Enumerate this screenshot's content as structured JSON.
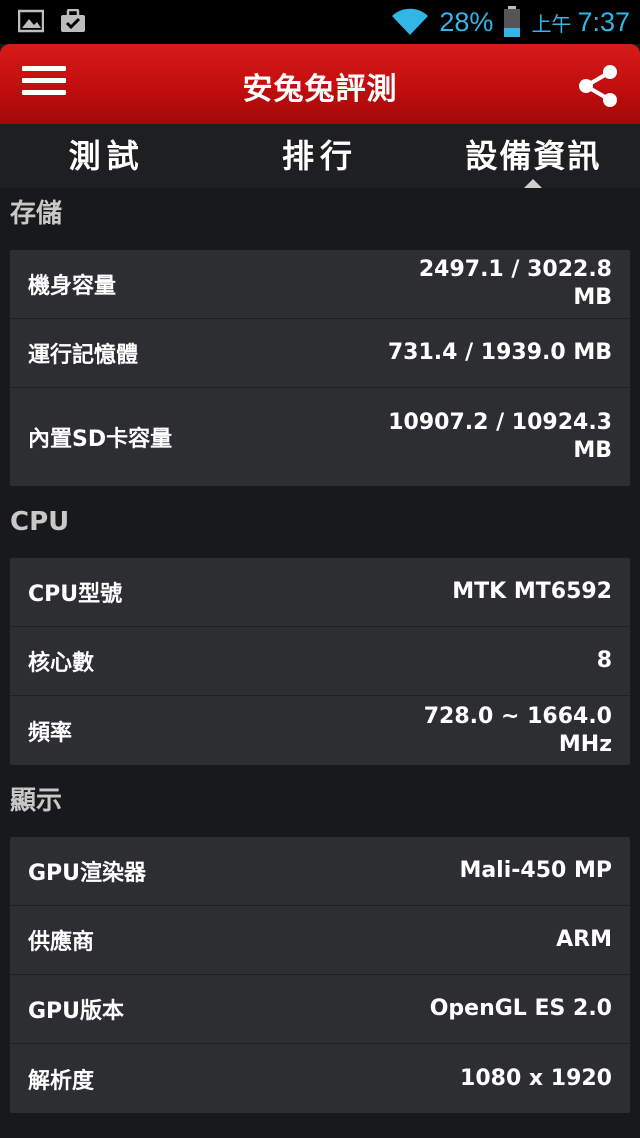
{
  "status_bar": {
    "battery_percent": "28%",
    "clock_ampm": "上午",
    "clock_time": "7:37",
    "accent_color": "#33b5e5",
    "icons": [
      "gallery-icon",
      "task-done-icon",
      "wifi-icon",
      "battery-icon"
    ]
  },
  "app_bar": {
    "title": "安兔兔評測",
    "background_color": "#c10e0e"
  },
  "tabs": [
    {
      "label": "測試",
      "active": false
    },
    {
      "label": "排行",
      "active": false
    },
    {
      "label": "設備資訊",
      "active": true
    }
  ],
  "sections": {
    "storage": {
      "title": "存儲",
      "rows": [
        {
          "label": "機身容量",
          "value": "2497.1 / 3022.8 MB"
        },
        {
          "label": "運行記憶體",
          "value": "731.4 / 1939.0 MB"
        },
        {
          "label": "內置SD卡容量",
          "value": "10907.2 / 10924.3 MB"
        }
      ]
    },
    "cpu": {
      "title": "CPU",
      "rows": [
        {
          "label": "CPU型號",
          "value": "MTK MT6592"
        },
        {
          "label": "核心數",
          "value": "8"
        },
        {
          "label": "頻率",
          "value": "728.0 ~ 1664.0 MHz"
        }
      ]
    },
    "display": {
      "title": "顯示",
      "rows": [
        {
          "label": "GPU渲染器",
          "value": "Mali-450 MP"
        },
        {
          "label": "供應商",
          "value": "ARM"
        },
        {
          "label": "GPU版本",
          "value": "OpenGL ES 2.0"
        },
        {
          "label": "解析度",
          "value": "1080 x 1920"
        }
      ]
    }
  }
}
